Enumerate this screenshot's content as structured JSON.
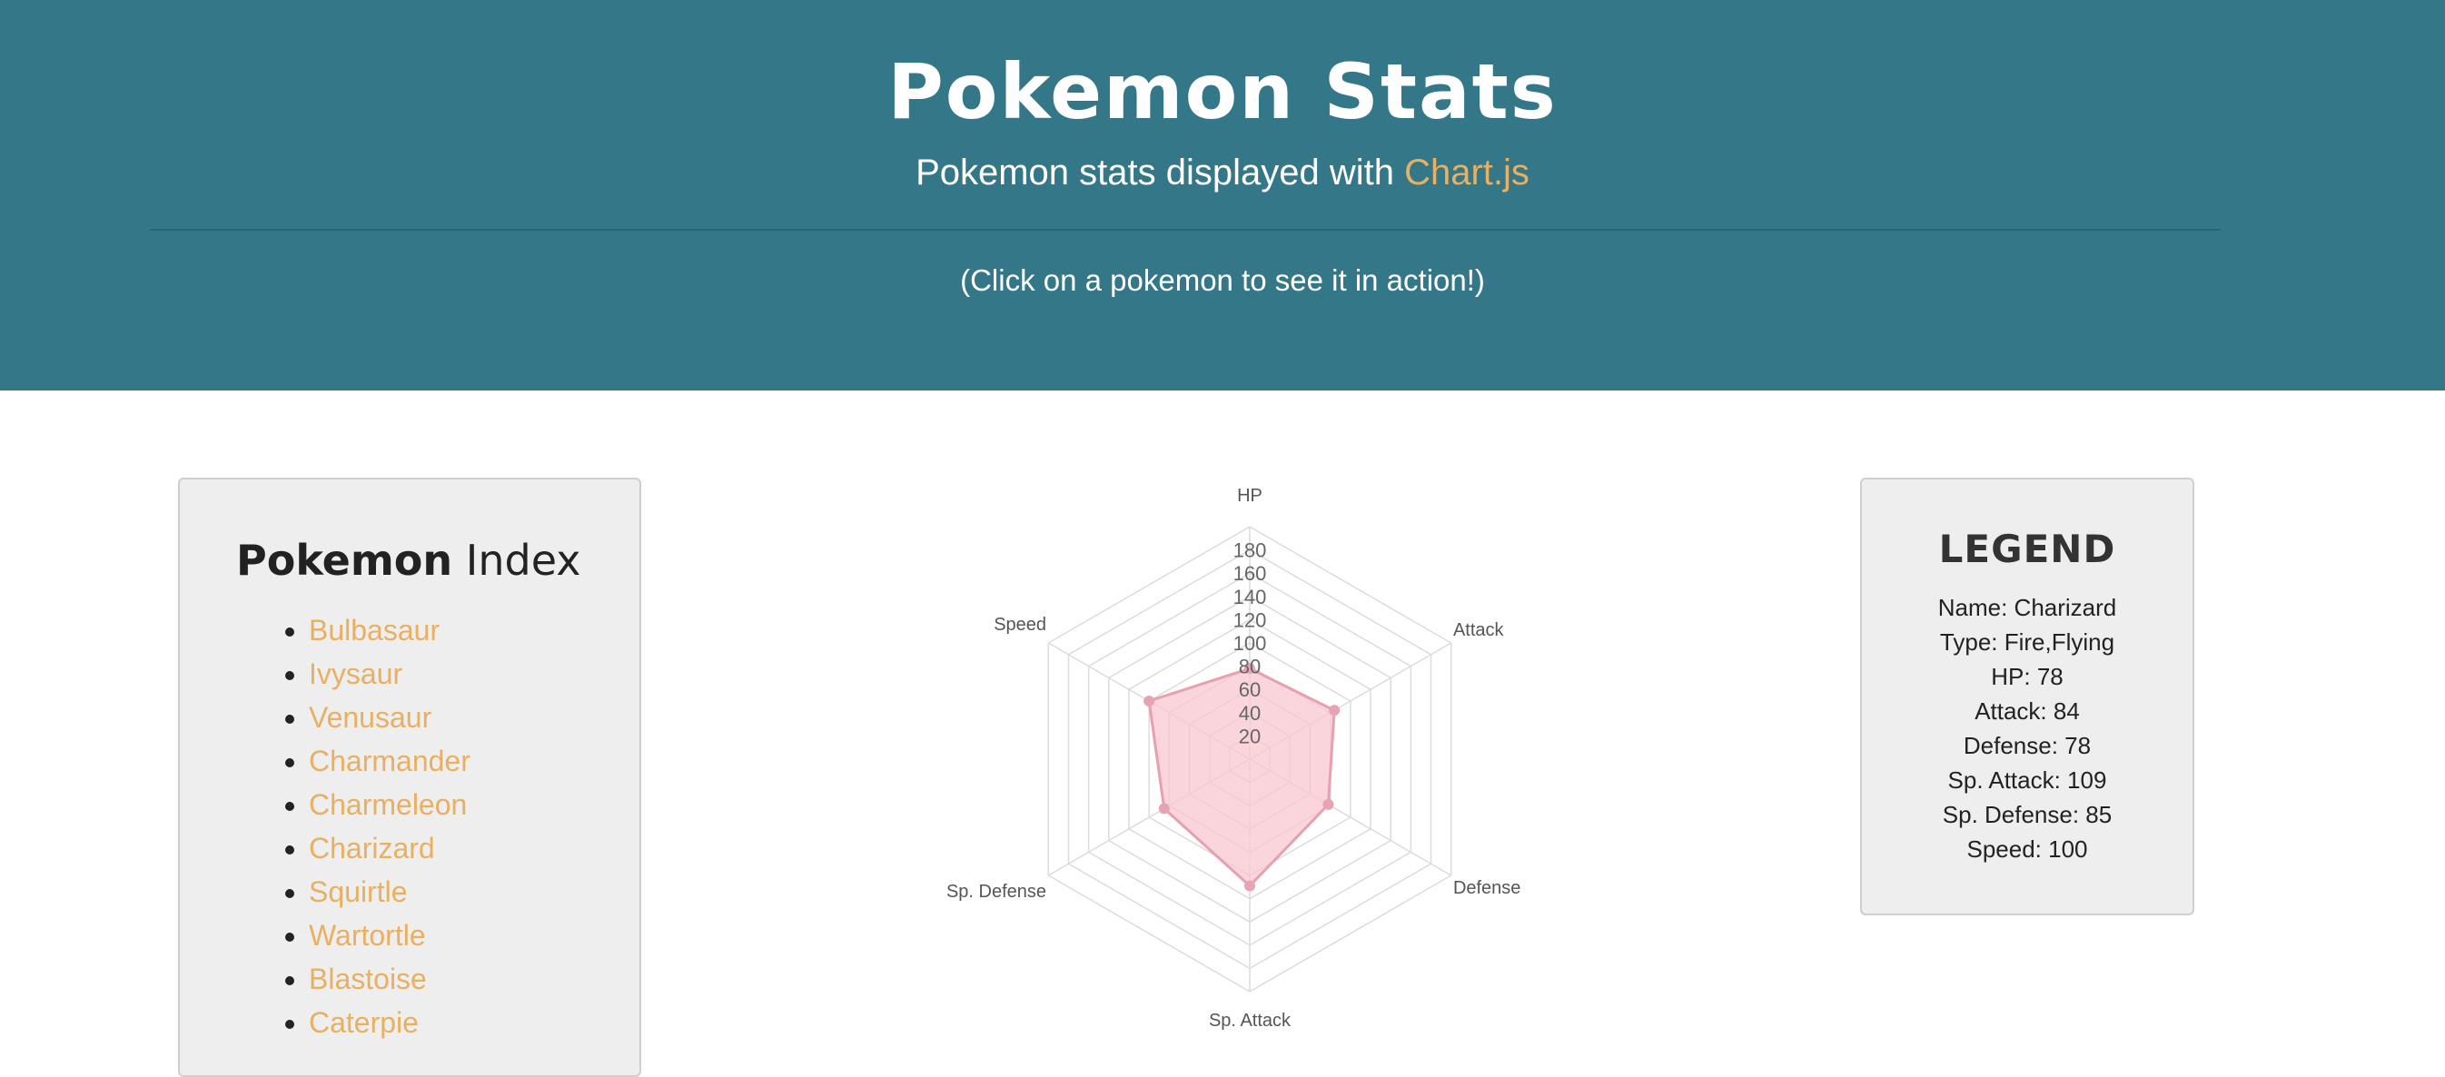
{
  "header": {
    "title": "Pokemon Stats",
    "subtitle_prefix": "Pokemon stats displayed with ",
    "subtitle_link": "Chart.js",
    "hint": "(Click on a pokemon to see it in action!)"
  },
  "index": {
    "title_bold": "Pokemon",
    "title_rest": " Index",
    "items": [
      "Bulbasaur",
      "Ivysaur",
      "Venusaur",
      "Charmander",
      "Charmeleon",
      "Charizard",
      "Squirtle",
      "Wartortle",
      "Blastoise",
      "Caterpie"
    ]
  },
  "legend": {
    "title": "LEGEND",
    "rows": [
      "Name: Charizard",
      "Type: Fire,Flying",
      "HP: 78",
      "Attack: 84",
      "Defense: 78",
      "Sp. Attack: 109",
      "Sp. Defense: 85",
      "Speed: 100"
    ]
  },
  "colors": {
    "header_bg": "#337789",
    "accent": "#e8b060",
    "fill": "#f8c8d0",
    "stroke": "#e8a0b0"
  },
  "chart_data": {
    "type": "radar",
    "categories": [
      "HP",
      "Attack",
      "Defense",
      "Sp. Attack",
      "Sp. Defense",
      "Speed"
    ],
    "series": [
      {
        "values": [
          78,
          84,
          78,
          109,
          85,
          100
        ]
      }
    ],
    "ticks": [
      "20",
      "40",
      "60",
      "80",
      "100",
      "120",
      "140",
      "160",
      "180"
    ],
    "rmax": 200
  }
}
